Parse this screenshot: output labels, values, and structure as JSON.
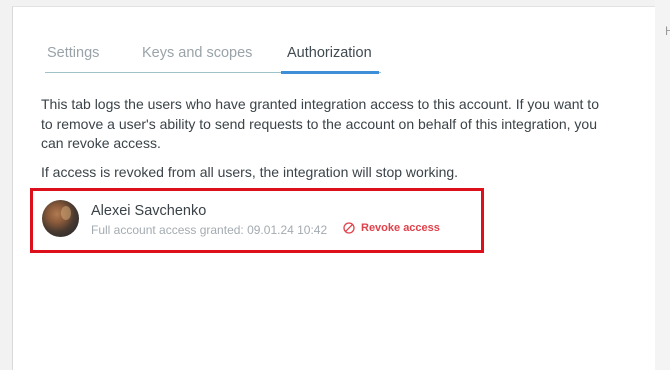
{
  "tabs": [
    {
      "label": "Settings",
      "active": false
    },
    {
      "label": "Keys and scopes",
      "active": false
    },
    {
      "label": "Authorization",
      "active": true
    }
  ],
  "content": {
    "description": "This tab logs the users who have granted integration access to this account. If you want to to remove a user's ability to send requests to the account on behalf of this integration, you can revoke access.",
    "notice": "If access is revoked from all users, the integration will stop working."
  },
  "authorizations": [
    {
      "user_name": "Alexei Savchenko",
      "grant_info": "Full account access granted: 09.01.24 10:42",
      "revoke_label": "Revoke access",
      "revoke_icon": "no-entry-icon"
    }
  ],
  "background_peek": "H",
  "colors": {
    "accent": "#3f8fd8",
    "tab_baseline": "#9fc3c8",
    "revoke": "#e0424b",
    "highlight": "#dd0f1a"
  }
}
